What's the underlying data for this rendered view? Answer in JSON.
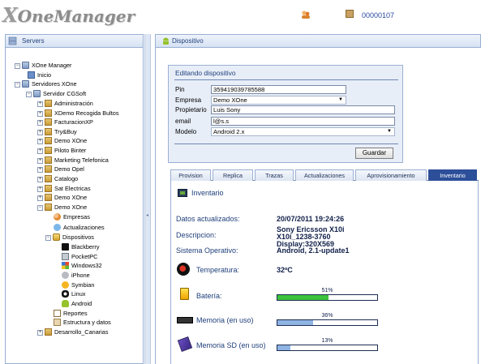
{
  "app": {
    "logo": "XOneManager",
    "header_code": "00000107"
  },
  "left_panel": {
    "title": "Servers"
  },
  "right_panel": {
    "title": "Dispositivo"
  },
  "tree": [
    {
      "label": "XOne Manager",
      "icon": "xone-icon",
      "expander": "⊟"
    },
    {
      "label": "Inicio",
      "icon": "home-icon",
      "expander": ""
    },
    {
      "label": "Servidores XOne",
      "icon": "server-icon",
      "expander": "⊟"
    },
    {
      "label": "Servidor CGSoft",
      "icon": "server-icon",
      "expander": "⊟"
    },
    {
      "label": "Administración",
      "icon": "folder-icon",
      "expander": "⊞"
    },
    {
      "label": "XDemo Recogida Bultos",
      "icon": "folder-icon",
      "expander": "⊞"
    },
    {
      "label": "FacturacionXP",
      "icon": "folder-icon",
      "expander": "⊞"
    },
    {
      "label": "Try&Buy",
      "icon": "folder-icon",
      "expander": "⊞"
    },
    {
      "label": "Demo XOne",
      "icon": "folder-icon",
      "expander": "⊞"
    },
    {
      "label": "Piloto Binter",
      "icon": "folder-icon",
      "expander": "⊞"
    },
    {
      "label": "Marketing Telefonica",
      "icon": "folder-icon",
      "expander": "⊞"
    },
    {
      "label": "Demo Opel",
      "icon": "folder-icon",
      "expander": "⊞"
    },
    {
      "label": "Catalogo",
      "icon": "folder-icon",
      "expander": "⊞"
    },
    {
      "label": "Sat Electricas",
      "icon": "folder-icon",
      "expander": "⊞"
    },
    {
      "label": "Demo XOne",
      "icon": "folder-icon",
      "expander": "⊞"
    },
    {
      "label": "Demo XOne",
      "icon": "folder-icon",
      "expander": "⊟"
    },
    {
      "label": "Empresas",
      "icon": "people-icon",
      "expander": ""
    },
    {
      "label": "Actualizaciones",
      "icon": "update-icon",
      "expander": ""
    },
    {
      "label": "Dispositivos",
      "icon": "device-icon",
      "expander": "⊟"
    },
    {
      "label": "Blackberry",
      "icon": "blackberry-icon",
      "expander": ""
    },
    {
      "label": "PocketPC",
      "icon": "pocketpc-icon",
      "expander": ""
    },
    {
      "label": "Windows32",
      "icon": "windows-icon",
      "expander": ""
    },
    {
      "label": "iPhone",
      "icon": "apple-icon",
      "expander": ""
    },
    {
      "label": "Symbian",
      "icon": "symbian-icon",
      "expander": ""
    },
    {
      "label": "Linux",
      "icon": "linux-icon",
      "expander": ""
    },
    {
      "label": "Android",
      "icon": "android-icon",
      "expander": ""
    },
    {
      "label": "Reportes",
      "icon": "report-icon",
      "expander": ""
    },
    {
      "label": "Estructura y datos",
      "icon": "structure-icon",
      "expander": ""
    },
    {
      "label": "Desarrollo_Canarias",
      "icon": "folder-icon",
      "expander": "⊞"
    }
  ],
  "form": {
    "title": "Editando dispositivo",
    "pin_label": "Pin",
    "pin_value": "359419039785588",
    "empresa_label": "Empresa",
    "empresa_value": "Demo XOne",
    "propietario_label": "Propietario",
    "propietario_value": "Luis Sony",
    "email_label": "email",
    "email_value": "l@s.s",
    "modelo_label": "Modelo",
    "modelo_value": "Android 2.x",
    "save_label": "Guardar"
  },
  "tabs": [
    "Provision",
    "Replica",
    "Trazas",
    "Actualizaciones",
    "Aprovisionamiento",
    "Inventario"
  ],
  "active_tab": "Inventario",
  "inventory": {
    "title": "Inventario",
    "updated_label": "Datos actualizados:",
    "updated_value": "20/07/2011 19:24:26",
    "description_label": "Descripcion:",
    "description_line1": "Sony Ericsson X10i",
    "description_line2": "X10i_1238-3760",
    "description_line3": "Display:320X569",
    "os_label": "Sistema Operativo:",
    "os_value": "Android, 2.1-update1",
    "temp_label": "Temperatura:",
    "temp_value": "32ºC",
    "battery_label": "Batería:",
    "battery_pct": "51%",
    "battery_fraction": 0.51,
    "memory_label": "Memoria (en uso)",
    "memory_pct": "36%",
    "memory_fraction": 0.36,
    "sd_label": "Memoria SD (en uso)",
    "sd_pct": "13%",
    "sd_fraction": 0.13
  },
  "colors": {
    "accent": "#2d4f9a",
    "battery_fill": "#3cc23c",
    "memory_fill": "#8fb4e3"
  }
}
